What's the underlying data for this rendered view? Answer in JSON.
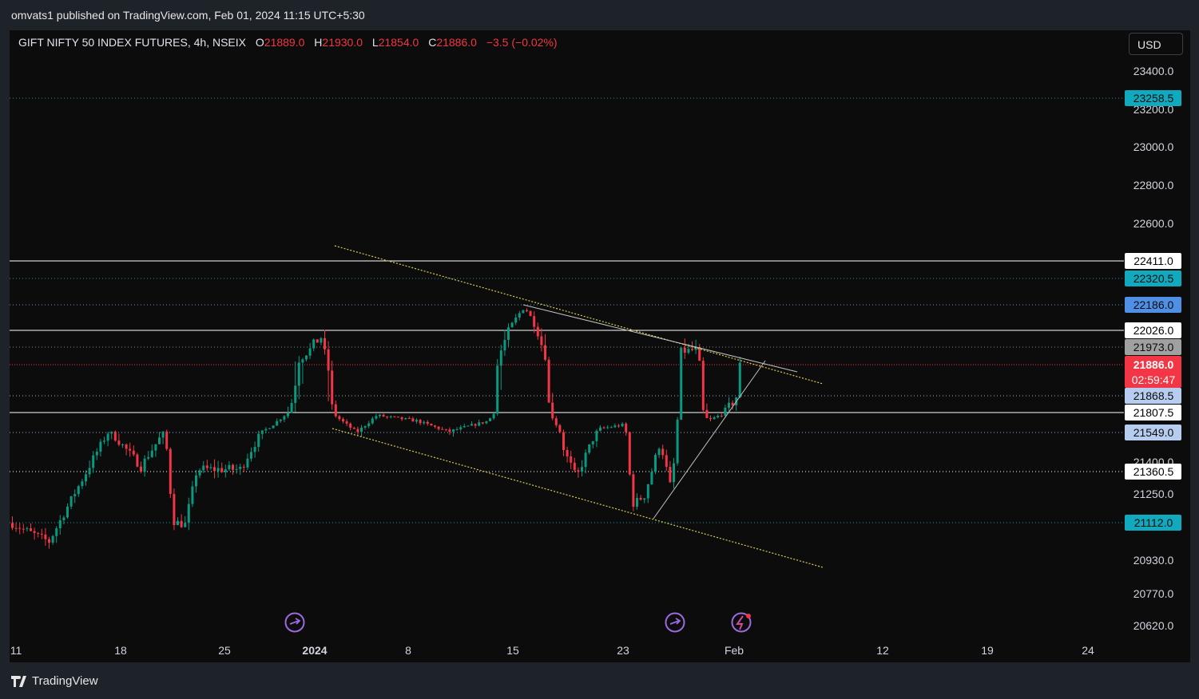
{
  "publisher_line": "omvats1 published on TradingView.com, Feb 01, 2024 11:15 UTC+5:30",
  "legend": {
    "title": "GIFT NIFTY 50 INDEX FUTURES, 4h, NSEIX",
    "open_key": "O",
    "open": "21889.0",
    "high_key": "H",
    "high": "21930.0",
    "low_key": "L",
    "low": "21854.0",
    "close_key": "C",
    "close": "21886.0",
    "change": "−3.5 (−0.02%)"
  },
  "currency": "USD",
  "footer_brand": "TradingView",
  "colors": {
    "up": "#089981",
    "down": "#f23645",
    "background": "#0c0c0c",
    "trendline": "#d8cf4a",
    "guide": "#c0c0c0"
  },
  "chart_data": {
    "type": "candlestick",
    "symbol": "GIFT NIFTY 50 INDEX FUTURES",
    "interval": "4h",
    "exchange": "NSEIX",
    "ylim": [
      20570,
      23520
    ],
    "x_tick_labels": [
      "11",
      "18",
      "25",
      "2024",
      "8",
      "15",
      "23",
      "Feb",
      "12",
      "19",
      "24"
    ],
    "y_tick_labels": [
      "23400.0",
      "23200.0",
      "23000.0",
      "22800.0",
      "22600.0",
      "21400.0",
      "21250.0",
      "20930.0",
      "20770.0",
      "20620.0"
    ],
    "price_levels": [
      {
        "value": "23258.5",
        "style": "dotted",
        "color": "#0e9fb0",
        "label_bg": "#11a9bd",
        "label_fg": "#0c0c0c"
      },
      {
        "value": "22411.0",
        "style": "solid",
        "color": "#ffffff",
        "label_bg": "#ffffff",
        "label_fg": "#000000"
      },
      {
        "value": "22320.5",
        "style": "dotted",
        "color": "#0e9fb0",
        "label_bg": "#11a9bd",
        "label_fg": "#0c0c0c"
      },
      {
        "value": "22186.0",
        "style": "dotted",
        "color": "#6b8fc7",
        "label_bg": "#4f8fe6",
        "label_fg": "#0c0c0c"
      },
      {
        "value": "22026.0",
        "style": "solid",
        "color": "#ffffff",
        "label_bg": "#ffffff",
        "label_fg": "#000000"
      },
      {
        "value": "21973.0",
        "style": "dotted",
        "color": "#888888",
        "label_bg": "#a0a0a0",
        "label_fg": "#0c0c0c"
      },
      {
        "value": "21868.5",
        "style": "dotted",
        "color": "#8fb0e0",
        "label_bg": "#b7cdf0",
        "label_fg": "#0c0c0c"
      },
      {
        "value": "21807.5",
        "style": "solid",
        "color": "#ffffff",
        "label_bg": "#ffffff",
        "label_fg": "#000000"
      },
      {
        "value": "21549.0",
        "style": "dotted",
        "color": "#8fb0e0",
        "label_bg": "#b7cdf0",
        "label_fg": "#0c0c0c"
      },
      {
        "value": "21360.5",
        "style": "dotted",
        "color": "#ffffff",
        "label_bg": "#ffffff",
        "label_fg": "#000000"
      },
      {
        "value": "21112.0",
        "style": "dotted",
        "color": "#0e9fb0",
        "label_bg": "#11a9bd",
        "label_fg": "#0c0c0c"
      }
    ],
    "last_price": {
      "value": "21886.0",
      "countdown": "02:59:47"
    },
    "candle_summary": {
      "count": 200,
      "start_close": 21110,
      "end_close": 21886,
      "low_approx": 20930,
      "high_approx": 22186
    }
  }
}
